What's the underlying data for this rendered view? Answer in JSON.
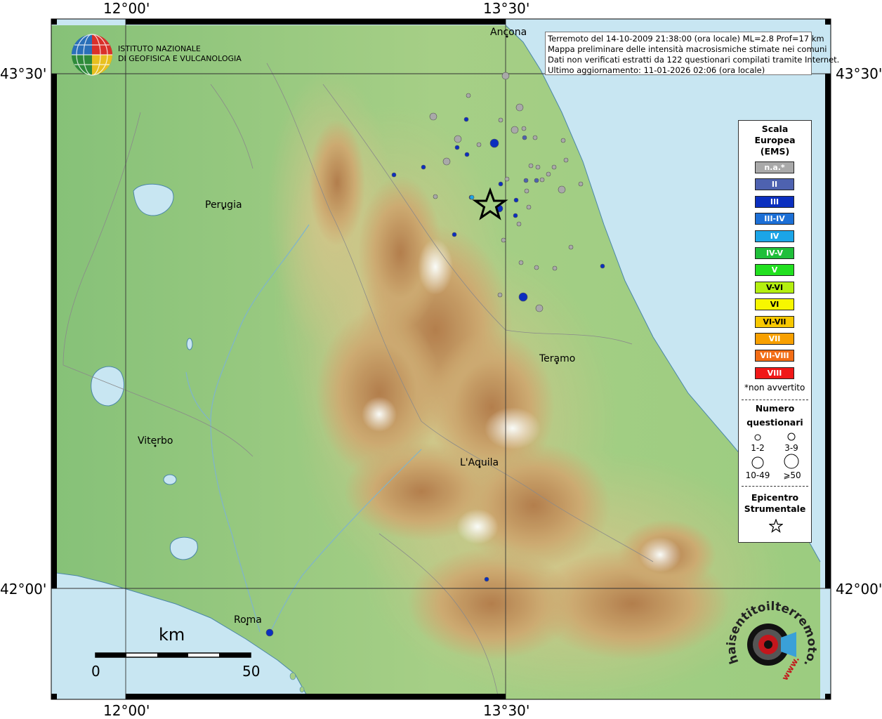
{
  "header": {
    "logo_line1": "ISTITUTO NAZIONALE",
    "logo_line2": "DI GEOFISICA E VULCANOLOGIA"
  },
  "coords": {
    "top_left": "12°00'",
    "top_right": "13°30'",
    "bottom_left": "12°00'",
    "bottom_right": "13°30'",
    "left_upper": "43°30'",
    "left_lower": "42°00'",
    "right_upper": "43°30'",
    "right_lower": "42°00'"
  },
  "info": {
    "line1": "Terremoto del 14-10-2009 21:38:00 (ora locale) ML=2.8 Prof=17 km",
    "line2": "Mappa preliminare delle intensità macrosismiche stimate nei comuni",
    "line3": "Dati non verificati estratti da 122 questionari compilati tramite Internet.",
    "line4": "Ultimo aggiornamento: 11-01-2026 02:06 (ora locale)"
  },
  "cities": {
    "ancona": "Ancona",
    "perugia": "Perugia",
    "teramo": "Teramo",
    "viterbo": "Viterbo",
    "laquila": "L'Aquila",
    "roma": "Roma"
  },
  "scale_bar": {
    "unit": "km",
    "min": "0",
    "max": "50"
  },
  "legend": {
    "title_line1": "Scala",
    "title_line2": "Europea",
    "title_line3": "(EMS)",
    "classes": [
      {
        "label": "n.a.*",
        "color": "#a9a9a9"
      },
      {
        "label": "II",
        "color": "#4e62b0"
      },
      {
        "label": "III",
        "color": "#0b2fbf"
      },
      {
        "label": "III-IV",
        "color": "#1c6fd6"
      },
      {
        "label": "IV",
        "color": "#1ba5e8"
      },
      {
        "label": "IV-V",
        "color": "#1fbf3a"
      },
      {
        "label": "V",
        "color": "#22e020"
      },
      {
        "label": "V-VI",
        "color": "#b4ef10"
      },
      {
        "label": "VI",
        "color": "#f7f700"
      },
      {
        "label": "VI-VII",
        "color": "#f8c800"
      },
      {
        "label": "VII",
        "color": "#f8a000"
      },
      {
        "label": "VII-VIII",
        "color": "#f36d16"
      },
      {
        "label": "VIII",
        "color": "#f01818"
      }
    ],
    "footnote": "*non avvertito",
    "count_title_line1": "Numero",
    "count_title_line2": "questionari",
    "sizes": [
      "1-2",
      "3-9",
      "10-49",
      "⩾50"
    ],
    "epicenter_line1": "Epicentro",
    "epicenter_line2": "Strumentale"
  },
  "site_logo": {
    "text": "haisentitoilterremoto.it",
    "url_text": "www."
  },
  "colors": {
    "sea": "#c8e6f2",
    "lowland": "#8fc97a",
    "hills": "#d9cc90",
    "mountains": "#b88654",
    "peaks": "#f4f4f4",
    "grey_point": "#a9a9a9",
    "ii_point": "#4e62b0",
    "iii_point": "#0b2fbf"
  }
}
